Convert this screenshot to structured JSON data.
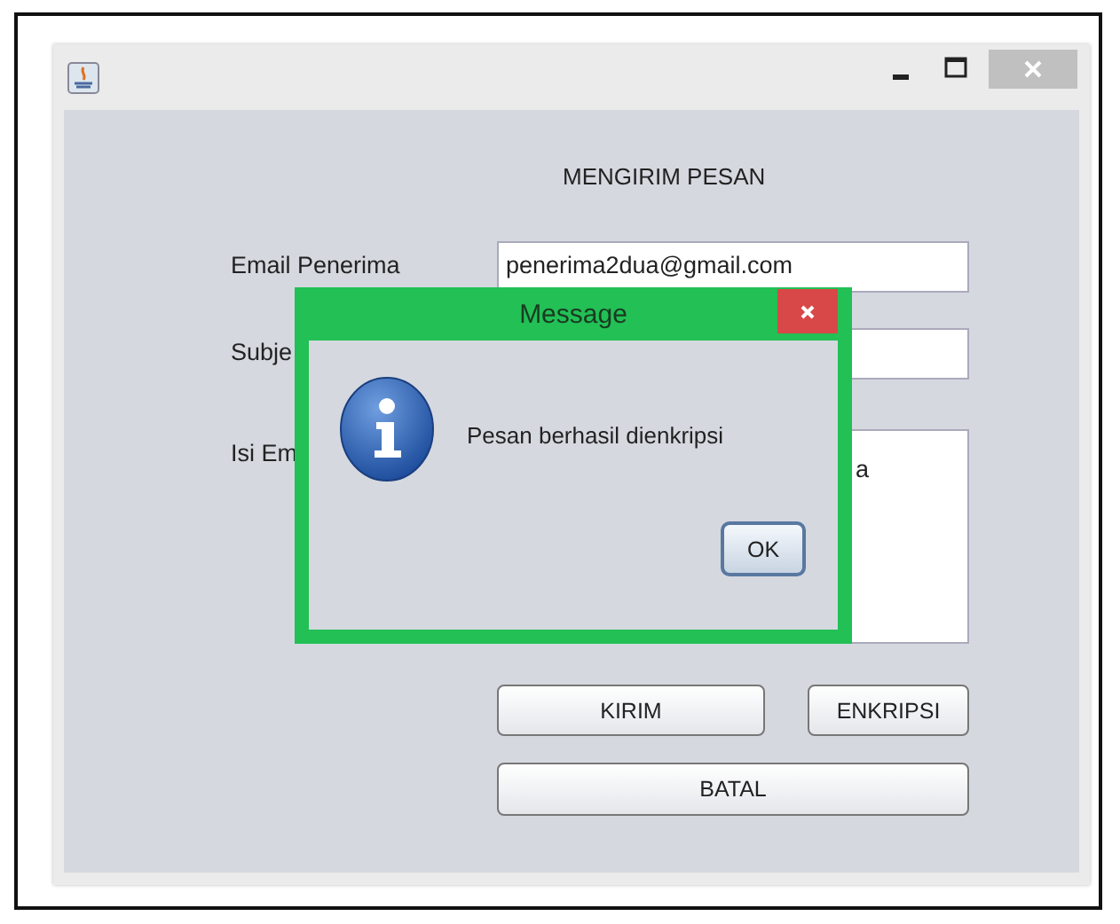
{
  "window": {
    "title": "MENGIRIM PESAN"
  },
  "form": {
    "fields": [
      {
        "label": "Email Penerima",
        "kind": "text",
        "value": "penerima2dua@gmail.com"
      },
      {
        "label": "Subje",
        "kind": "text"
      },
      {
        "label": "Isi Em",
        "kind": "area",
        "value": "a"
      }
    ]
  },
  "buttons": [
    "KIRIM",
    "ENKRIPSI",
    "BATAL"
  ],
  "dialog": {
    "title": "Message",
    "message": "Pesan berhasil dienkripsi",
    "button": "OK"
  }
}
